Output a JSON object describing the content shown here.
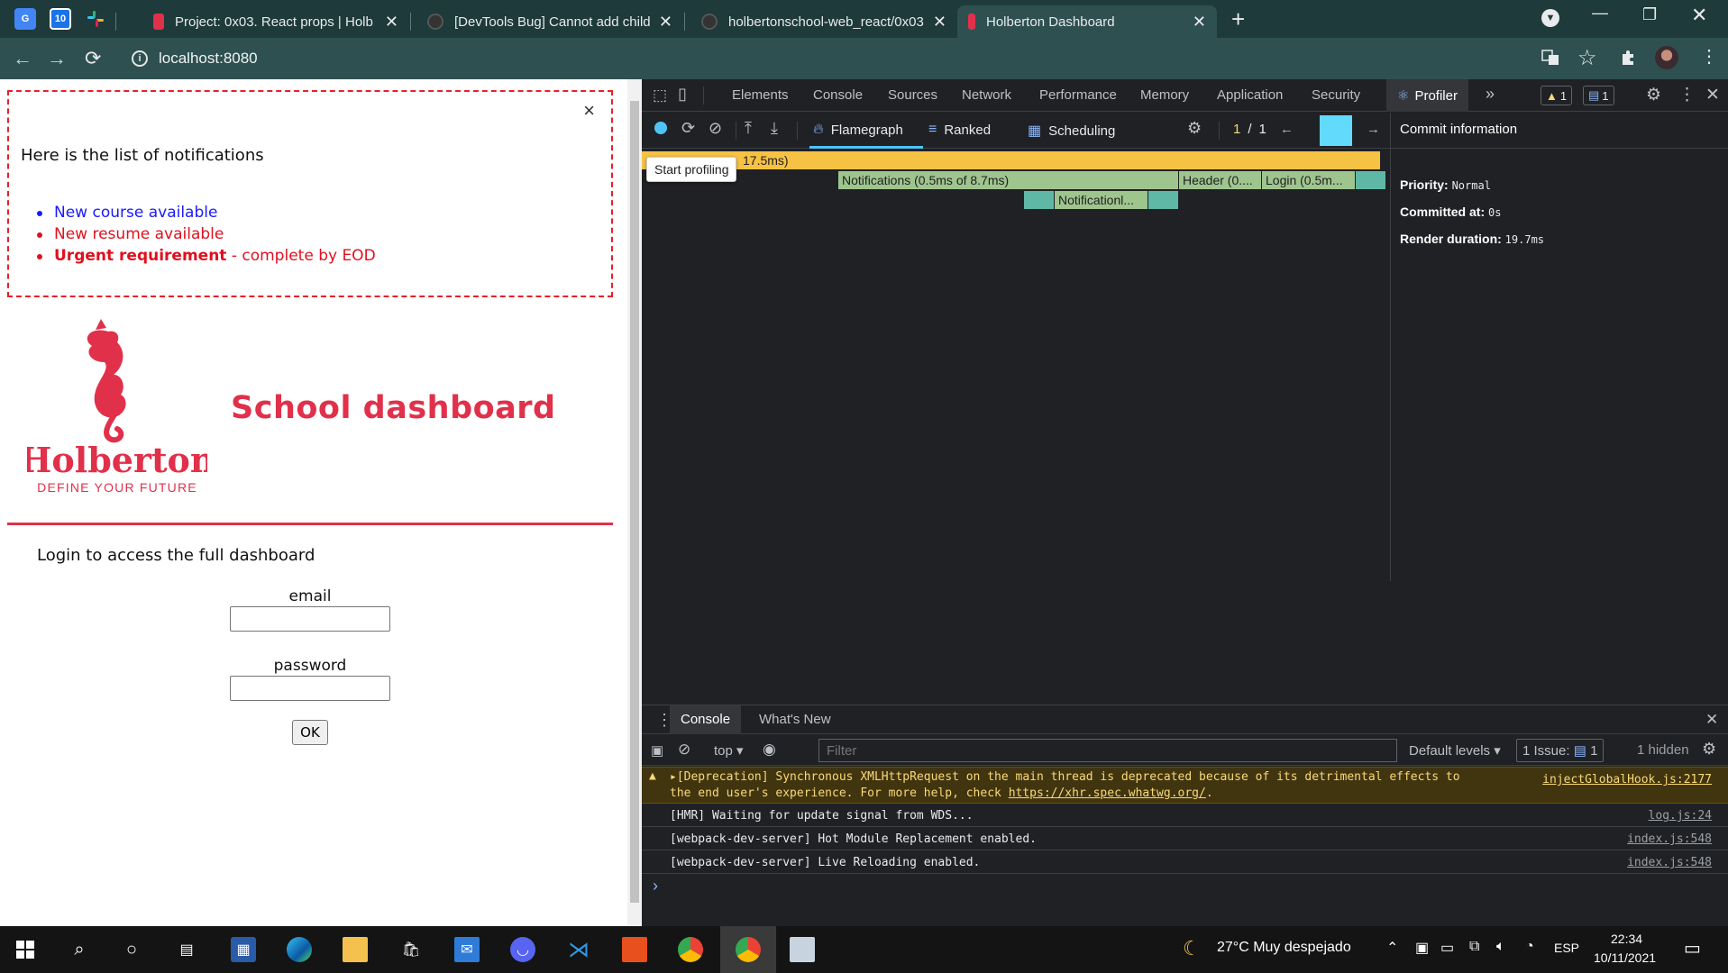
{
  "browser": {
    "tabs": [
      {
        "title": "Project: 0x03. React props | Holbe",
        "active": false
      },
      {
        "title": "[DevTools Bug] Cannot add child",
        "active": false
      },
      {
        "title": "holbertonschool-web_react/0x03",
        "active": false
      },
      {
        "title": "Holberton Dashboard",
        "active": true
      }
    ],
    "url": "localhost:8080"
  },
  "page": {
    "notifications": {
      "close_symbol": "×",
      "title": "Here is the list of notifications",
      "items": [
        {
          "type": "default",
          "text": "New course available"
        },
        {
          "type": "urgent",
          "text": "New resume available"
        },
        {
          "type": "urgent",
          "strong": "Urgent requirement",
          "rest": " - complete by EOD"
        }
      ]
    },
    "logo": {
      "wordmark": "Holberton",
      "tagline": "DEFINE YOUR FUTURE"
    },
    "title": "School dashboard",
    "login": {
      "intro": "Login to access the full dashboard",
      "email_label": "email",
      "password_label": "password",
      "submit_label": "OK"
    }
  },
  "devtools": {
    "tabs": [
      "Elements",
      "Console",
      "Sources",
      "Network",
      "Performance",
      "Memory",
      "Application",
      "Security",
      "Profiler"
    ],
    "active_tab": "Profiler",
    "more": "»",
    "warnings_count": "1",
    "messages_count": "1",
    "profiler": {
      "views": [
        "Flamegraph",
        "Ranked",
        "Scheduling"
      ],
      "active_view": "Flamegraph",
      "commit_index": "1",
      "commit_sep": "/",
      "commit_total": "1",
      "tooltip": "Start profiling",
      "bars": [
        {
          "label": "17.5ms)",
          "row": 0
        },
        {
          "label": "Notifications (0.5ms of 8.7ms)",
          "row": 1
        },
        {
          "label": "Header (0....",
          "row": 1
        },
        {
          "label": "Login (0.5m...",
          "row": 1
        },
        {
          "label": "Notificationl...",
          "row": 2
        }
      ],
      "commit_info": {
        "heading": "Commit information",
        "priority_label": "Priority:",
        "priority": "Normal",
        "committed_label": "Committed at:",
        "committed": "0s",
        "render_label": "Render duration:",
        "render": "19.7ms"
      }
    },
    "drawer": {
      "tabs": [
        "Console",
        "What's New"
      ],
      "context": "top",
      "filter_placeholder": "Filter",
      "levels": "Default levels",
      "issues_label": "1 Issue:",
      "issues_count": "1",
      "hidden": "1 hidden",
      "messages": [
        {
          "level": "warning",
          "text1": "▸[Deprecation] Synchronous XMLHttpRequest on the main thread is deprecated because of its detrimental effects to",
          "text2": "the end user's experience. For more help, check ",
          "link": "https://xhr.spec.whatwg.org/",
          "text3": ".",
          "source": "injectGlobalHook.js:2177"
        },
        {
          "level": "info",
          "text": "[HMR] Waiting for update signal from WDS...",
          "source": "log.js:24"
        },
        {
          "level": "info",
          "text": "[webpack-dev-server] Hot Module Replacement enabled.",
          "source": "index.js:548"
        },
        {
          "level": "info",
          "text": "[webpack-dev-server] Live Reloading enabled.",
          "source": "index.js:548"
        }
      ],
      "prompt": "›"
    }
  },
  "taskbar": {
    "weather": "27°C  Muy despejado",
    "language": "ESP",
    "time": "22:34",
    "date": "10/11/2021",
    "pinned_calendar_day": "10"
  },
  "colors": {
    "accent": "#e1304a",
    "notif_default": "#1a1aff",
    "notif_urgent": "#e0101e",
    "flame_yellow": "#f6c244",
    "flame_green": "#9fc58f",
    "flame_teal": "#5fb8a6"
  }
}
